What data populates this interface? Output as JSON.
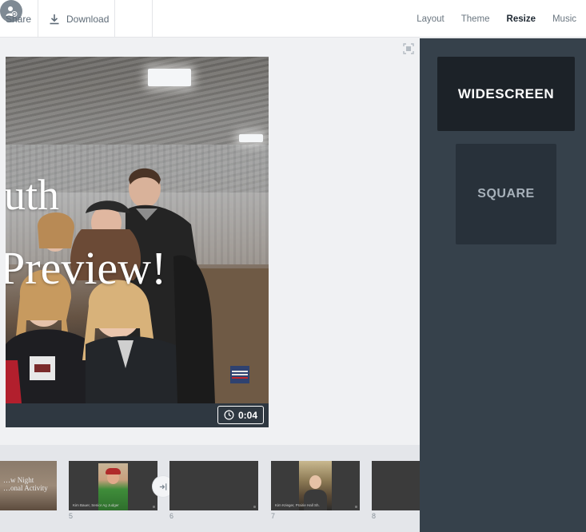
{
  "toolbar": {
    "share_label": "Share",
    "download_label": "Download",
    "download_icon": "download-icon",
    "collaborator_icon": "add-collaborator-icon"
  },
  "tabs": [
    {
      "label": "Layout",
      "active": false
    },
    {
      "label": "Theme",
      "active": false
    },
    {
      "label": "Resize",
      "active": true
    },
    {
      "label": "Music",
      "active": false
    }
  ],
  "resize_panel": {
    "widescreen_label": "WIDESCREEN",
    "square_label": "SQUARE",
    "selected": "WIDESCREEN"
  },
  "preview": {
    "headline_line1": "uth",
    "headline_line2": "Preview!",
    "duration": "0:04"
  },
  "timeline": {
    "slides": [
      {
        "number": "",
        "text": "…w Night\n…onal Activity"
      },
      {
        "number": "5",
        "caption": "Kim Bauer, Senior Ag Judger"
      },
      {
        "number": "6",
        "caption": ""
      },
      {
        "number": "7",
        "caption": "Kim Krieger, Prairie Hall Sh."
      },
      {
        "number": "8",
        "caption": ""
      }
    ]
  },
  "colors": {
    "panel_bg": "#36414b",
    "selected_btn": "#1c2228",
    "unselected_btn": "#28313a",
    "active_tab": "#1e2832"
  }
}
